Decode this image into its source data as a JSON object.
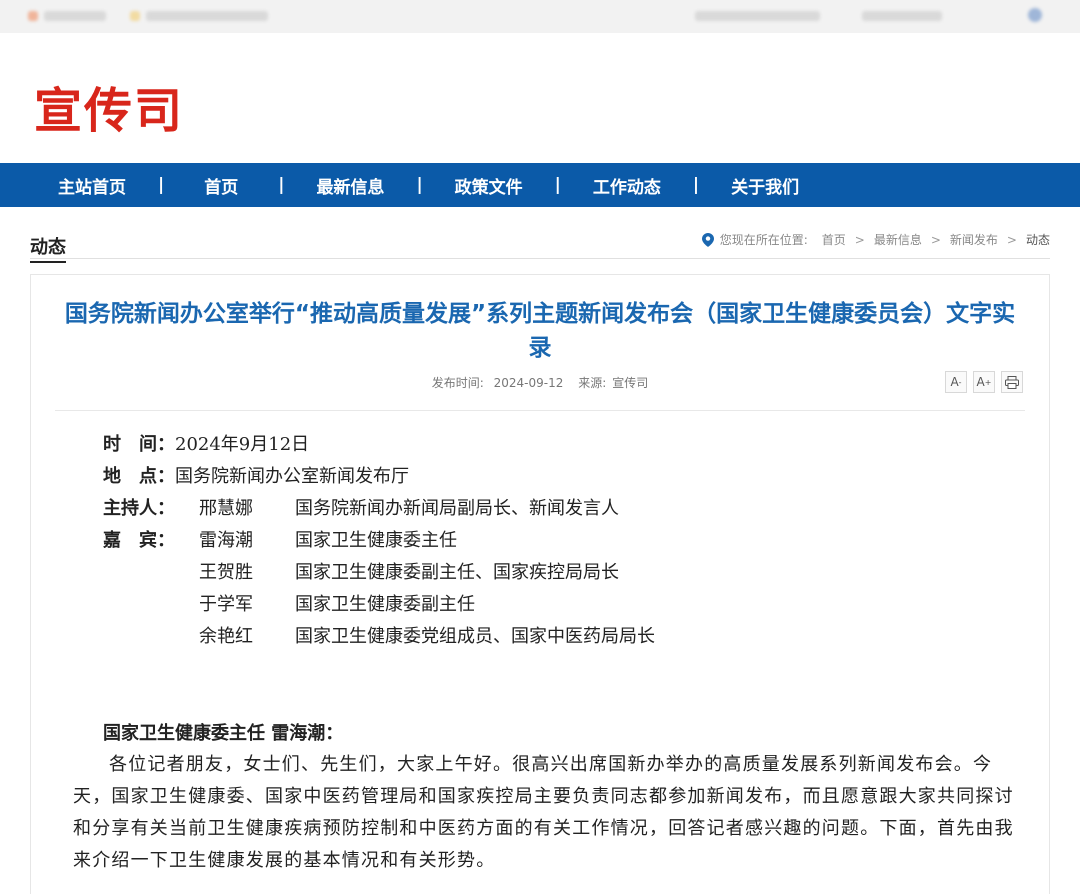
{
  "site": {
    "logo_text": "宣传司"
  },
  "nav": {
    "items": [
      "主站首页",
      "首页",
      "最新信息",
      "政策文件",
      "工作动态",
      "关于我们"
    ],
    "separator": "|"
  },
  "section": {
    "title": "动态"
  },
  "breadcrumb": {
    "prefix": "您现在所在位置:",
    "items": [
      "首页",
      "最新信息",
      "新闻发布"
    ],
    "current": "动态",
    "separator": ">"
  },
  "article": {
    "title": "国务院新闻办公室举行“推动高质量发展”系列主题新闻发布会（国家卫生健康委员会）文字实录",
    "meta": {
      "date_label": "发布时间:",
      "date": "2024-09-12",
      "source_label": "来源:",
      "source": "宣传司"
    },
    "tools": {
      "font_smaller": "A",
      "font_larger": "A",
      "print": "print-icon"
    },
    "info": {
      "time_label": "时　间：",
      "time_value": "2024年9月12日",
      "place_label": "地　点：",
      "place_value": "国务院新闻办公室新闻发布厅",
      "host_label": "主持人：",
      "host_name": "邢慧娜",
      "host_role": "国务院新闻办新闻局副局长、新闻发言人",
      "guests_label": "嘉　宾：",
      "guests": [
        {
          "name": "雷海潮",
          "role": "国家卫生健康委主任"
        },
        {
          "name": "王贺胜",
          "role": "国家卫生健康委副主任、国家疾控局局长"
        },
        {
          "name": "于学军",
          "role": "国家卫生健康委副主任"
        },
        {
          "name": "余艳红",
          "role": "国家卫生健康委党组成员、国家中医药局局长"
        }
      ]
    },
    "speaker": "国家卫生健康委主任 雷海潮：",
    "paragraph": "各位记者朋友，女士们、先生们，大家上午好。很高兴出席国新办举办的高质量发展系列新闻发布会。今天，国家卫生健康委、国家中医药管理局和国家疾控局主要负责同志都参加新闻发布，而且愿意跟大家共同探讨和分享有关当前卫生健康疾病预防控制和中医药方面的有关工作情况，回答记者感兴趣的问题。下面，首先由我来介绍一下卫生健康发展的基本情况和有关形势。"
  },
  "colors": {
    "brand_red": "#d8261b",
    "nav_blue": "#0b5aa8",
    "title_blue": "#1a67b0"
  }
}
